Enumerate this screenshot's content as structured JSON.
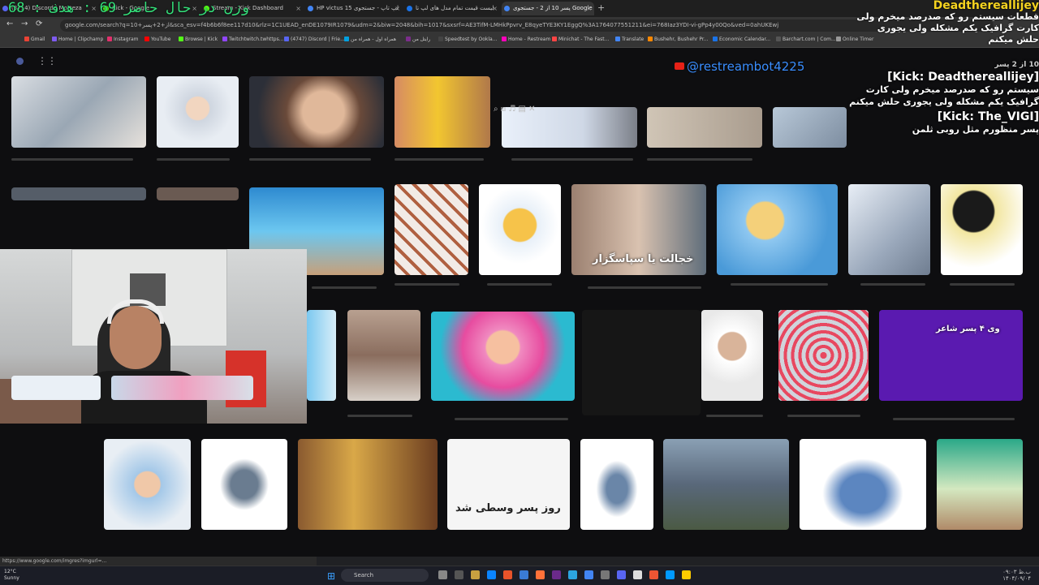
{
  "tabs": [
    {
      "label": "(3714) Discord | Morteza",
      "color": "#5865f2"
    },
    {
      "label": "Kick - Google",
      "color": "#53fc18"
    },
    {
      "label": "Stream - Kick Dashboard",
      "color": "#53fc18"
    },
    {
      "label": "HP victus 15 لپ تاپ - جستجوی",
      "color": "#4285f4"
    },
    {
      "label": "لیست قیمت تمام مدل های لپ تا",
      "color": "#1a73e8"
    },
    {
      "label": "پسر 10 از 2 - جستجوی Google",
      "color": "#4285f4"
    }
  ],
  "url": "google.com/search?q=10+از+2+پسر&sca_esv=f4b6b6f8ee117d10&rlz=1C1UEAD_enDE1079IR1079&udm=2&biw=2048&bih=1017&sxsrf=AE3TifM-LMHkPpvrv_E8qyeTYE3KY1EggQ%3A1764077551211&ei=768Iaz3YDI-vi-gPp4y00Qo&ved=0ahUKEwj",
  "bookmarks": [
    {
      "label": "Gmail",
      "color": "#ea4335"
    },
    {
      "label": "Home | Clipchamp",
      "color": "#7e5bef"
    },
    {
      "label": "Instagram",
      "color": "#e1306c"
    },
    {
      "label": "YouTube",
      "color": "#ff0000"
    },
    {
      "label": "Browse | Kick",
      "color": "#53fc18"
    },
    {
      "label": "Twitchtwitch.twhttps...",
      "color": "#9146ff"
    },
    {
      "label": "(4747) Discord | Frie...",
      "color": "#5865f2"
    },
    {
      "label": "همراه اول - همراه من",
      "color": "#00a0e0"
    },
    {
      "label": "رایتل من",
      "color": "#7b2d8b"
    },
    {
      "label": "Speedtest by Ookla...",
      "color": "#222"
    },
    {
      "label": "Home - Restream",
      "color": "#f0b"
    },
    {
      "label": "Minichat - The Fast...",
      "color": "#f44"
    },
    {
      "label": "Translate",
      "color": "#4285f4"
    },
    {
      "label": "Bushehr, Bushehr Pr...",
      "color": "#f80"
    },
    {
      "label": "Economic Calendar...",
      "color": "#1a73e8"
    },
    {
      "label": "Barchart.com | Com...",
      "color": "#333"
    },
    {
      "label": "Online Timer",
      "color": "#999"
    }
  ],
  "overlay": {
    "stat_line": "68 : وزن در حال حاضر 69 : هدف",
    "top_yellow": "Deadthereallijey",
    "top_lines": [
      "قطعات سیستم رو که صدرصد میخرم ولی",
      "کارت گرافیک یکم مشکله ولی یجوری",
      "حلش میکنم"
    ],
    "restream_user": "@restreambot4225",
    "chat_head_1": "[Kick: Deadthereallijey]",
    "chat_msg_1": "سیستم رو که صدرصد میخرم ولی کارت گرافیک یکم مشکله ولی یجوری حلش میکنم",
    "chat_head_2": "[Kick: The_VIGI]",
    "chat_msg_2": "پسر منظورم مثل روبی ثلمن",
    "google_logo": "Google",
    "page_counter": "10 از 2 پسر"
  },
  "captions": {
    "img_text_1": "خجالت یا سپاسگزار",
    "img_text_2": "روز پسر وسطی شد",
    "img_text_3": "وی ۴ پسر شاعر"
  },
  "status_url": "https://www.google.com/imgres?imgurl=...",
  "taskbar": {
    "weather_temp": "12°C",
    "weather_desc": "Sunny",
    "search_label": "Search",
    "time": "۰۹:۰۳ ب.ظ",
    "date": "۱۴۰۴/۰۹/۰۴"
  },
  "colors": {
    "accent_green": "#34e07a",
    "restream_blue": "#3a8eff",
    "kick_yellow": "#f5d320"
  }
}
